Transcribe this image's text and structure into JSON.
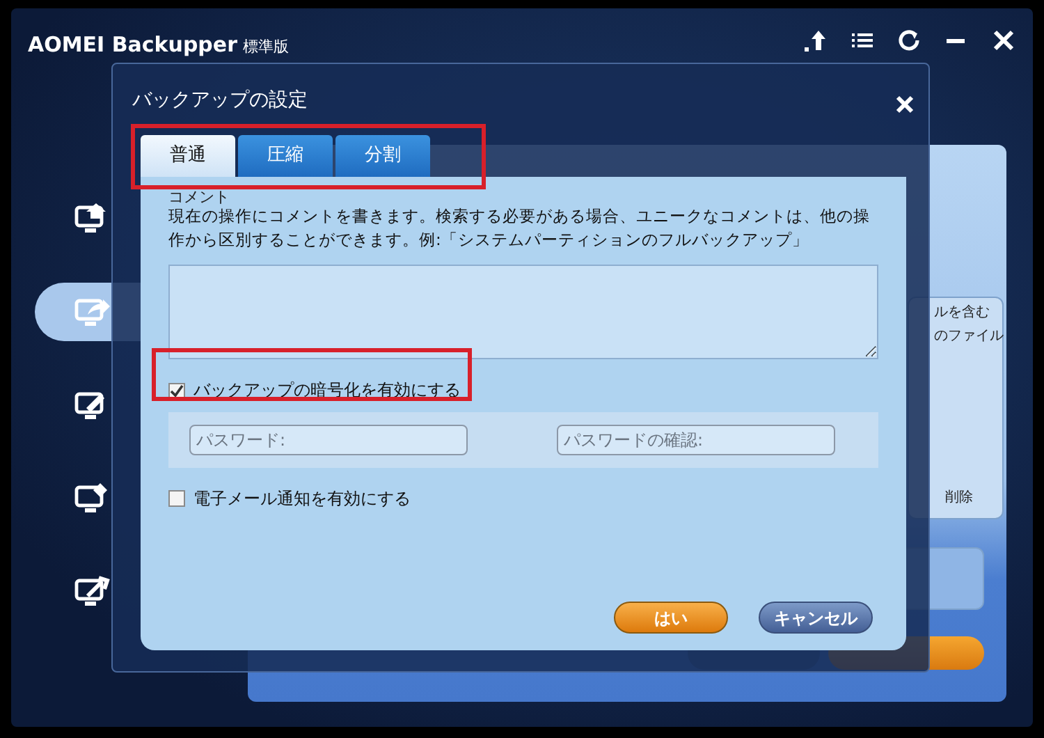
{
  "window": {
    "title": "AOMEI Backupper",
    "edition": "標準版"
  },
  "sidebar": {
    "items": [
      {
        "kind": "home",
        "selected": false
      },
      {
        "kind": "backup",
        "selected": true
      },
      {
        "kind": "restore",
        "selected": false
      },
      {
        "kind": "clone",
        "selected": false
      },
      {
        "kind": "tools",
        "selected": false
      }
    ]
  },
  "background_panel": {
    "list_lines": [
      "ルを含む",
      "のファイル"
    ],
    "delete_label": "削除"
  },
  "dialog": {
    "title": "バックアップの設定",
    "tabs": [
      {
        "label": "普通",
        "selected": true
      },
      {
        "label": "圧縮",
        "selected": false
      },
      {
        "label": "分割",
        "selected": false
      }
    ],
    "comment_label": "コメント",
    "comment_help": "現在の操作にコメントを書きます。検索する必要がある場合、ユニークなコメントは、他の操作から区別することができます。例:「システムパーティションのフルバックアップ」",
    "encryption": {
      "label": "バックアップの暗号化を有効にする",
      "checked": true
    },
    "password": {
      "placeholder": "パスワード:"
    },
    "password_confirm": {
      "placeholder": "パスワードの確認:"
    },
    "email": {
      "label": "電子メール通知を有効にする",
      "checked": false
    },
    "buttons": [
      {
        "label": "はい",
        "kind": "primary"
      },
      {
        "label": "キャンセル",
        "kind": "secondary"
      }
    ]
  }
}
